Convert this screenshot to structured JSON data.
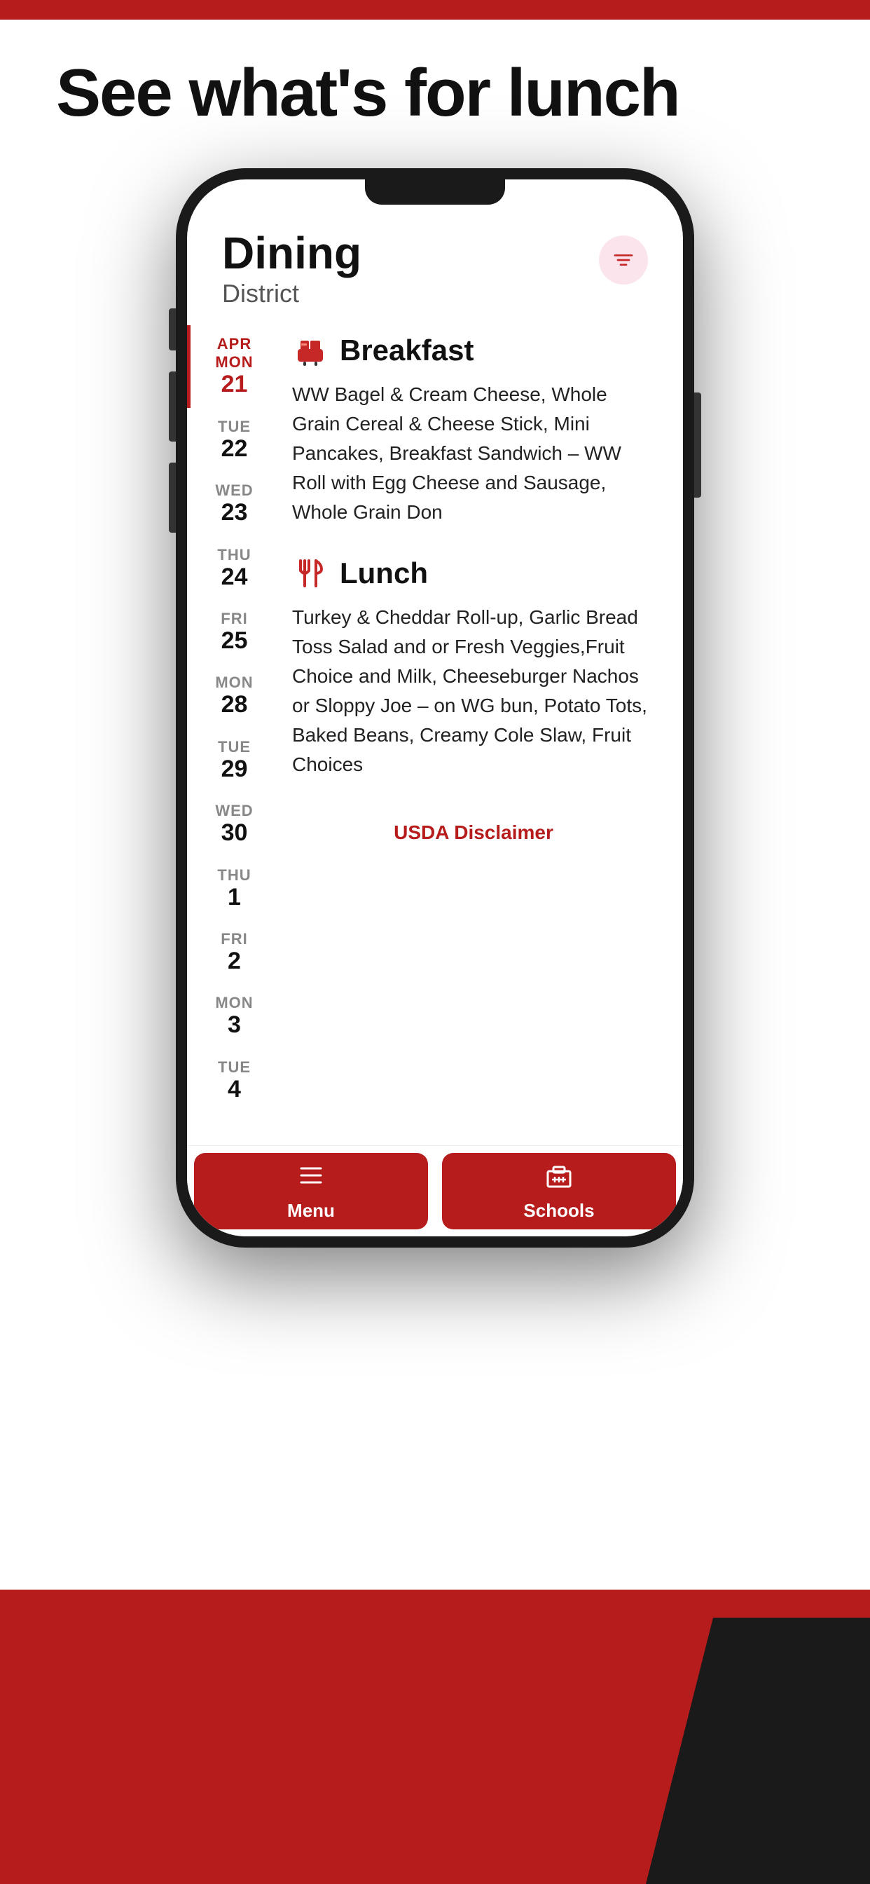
{
  "page": {
    "headline": "See what's for lunch",
    "bg_top_color": "#b71c1c",
    "bg_bottom_color": "#b71c1c"
  },
  "app": {
    "title": "Dining",
    "subtitle": "District",
    "filter_icon": "filter-icon",
    "usda_disclaimer": "USDA Disclaimer"
  },
  "calendar": {
    "days": [
      {
        "dow": "APR",
        "date": "21",
        "day_label": "MON",
        "active": true
      },
      {
        "dow": "TUE",
        "date": "22",
        "active": false
      },
      {
        "dow": "WED",
        "date": "23",
        "active": false
      },
      {
        "dow": "THU",
        "date": "24",
        "active": false
      },
      {
        "dow": "FRI",
        "date": "25",
        "active": false
      },
      {
        "dow": "MON",
        "date": "28",
        "active": false
      },
      {
        "dow": "TUE",
        "date": "29",
        "active": false
      },
      {
        "dow": "WED",
        "date": "30",
        "active": false
      },
      {
        "dow": "THU",
        "date": "1",
        "active": false
      },
      {
        "dow": "FRI",
        "date": "2",
        "active": false
      },
      {
        "dow": "MON",
        "date": "3",
        "active": false
      },
      {
        "dow": "TUE",
        "date": "4",
        "active": false
      }
    ]
  },
  "meals": [
    {
      "id": "breakfast",
      "name": "Breakfast",
      "icon": "breakfast-icon",
      "description": "WW Bagel & Cream Cheese, Whole Grain Cereal & Cheese Stick, Mini Pancakes, Breakfast Sandwich – WW Roll with Egg Cheese and Sausage, Whole Grain Don"
    },
    {
      "id": "lunch",
      "name": "Lunch",
      "icon": "lunch-icon",
      "description": "Turkey & Cheddar Roll-up, Garlic Bread Toss Salad and or Fresh Veggies,Fruit Choice and Milk, Cheeseburger Nachos or Sloppy Joe – on WG bun, Potato Tots, Baked Beans, Creamy Cole Slaw, Fruit Choices"
    }
  ],
  "bottom_nav": {
    "items": [
      {
        "id": "menu",
        "label": "Menu",
        "icon": "menu-icon",
        "active": true
      },
      {
        "id": "schools",
        "label": "Schools",
        "icon": "schools-icon",
        "active": true
      }
    ]
  }
}
